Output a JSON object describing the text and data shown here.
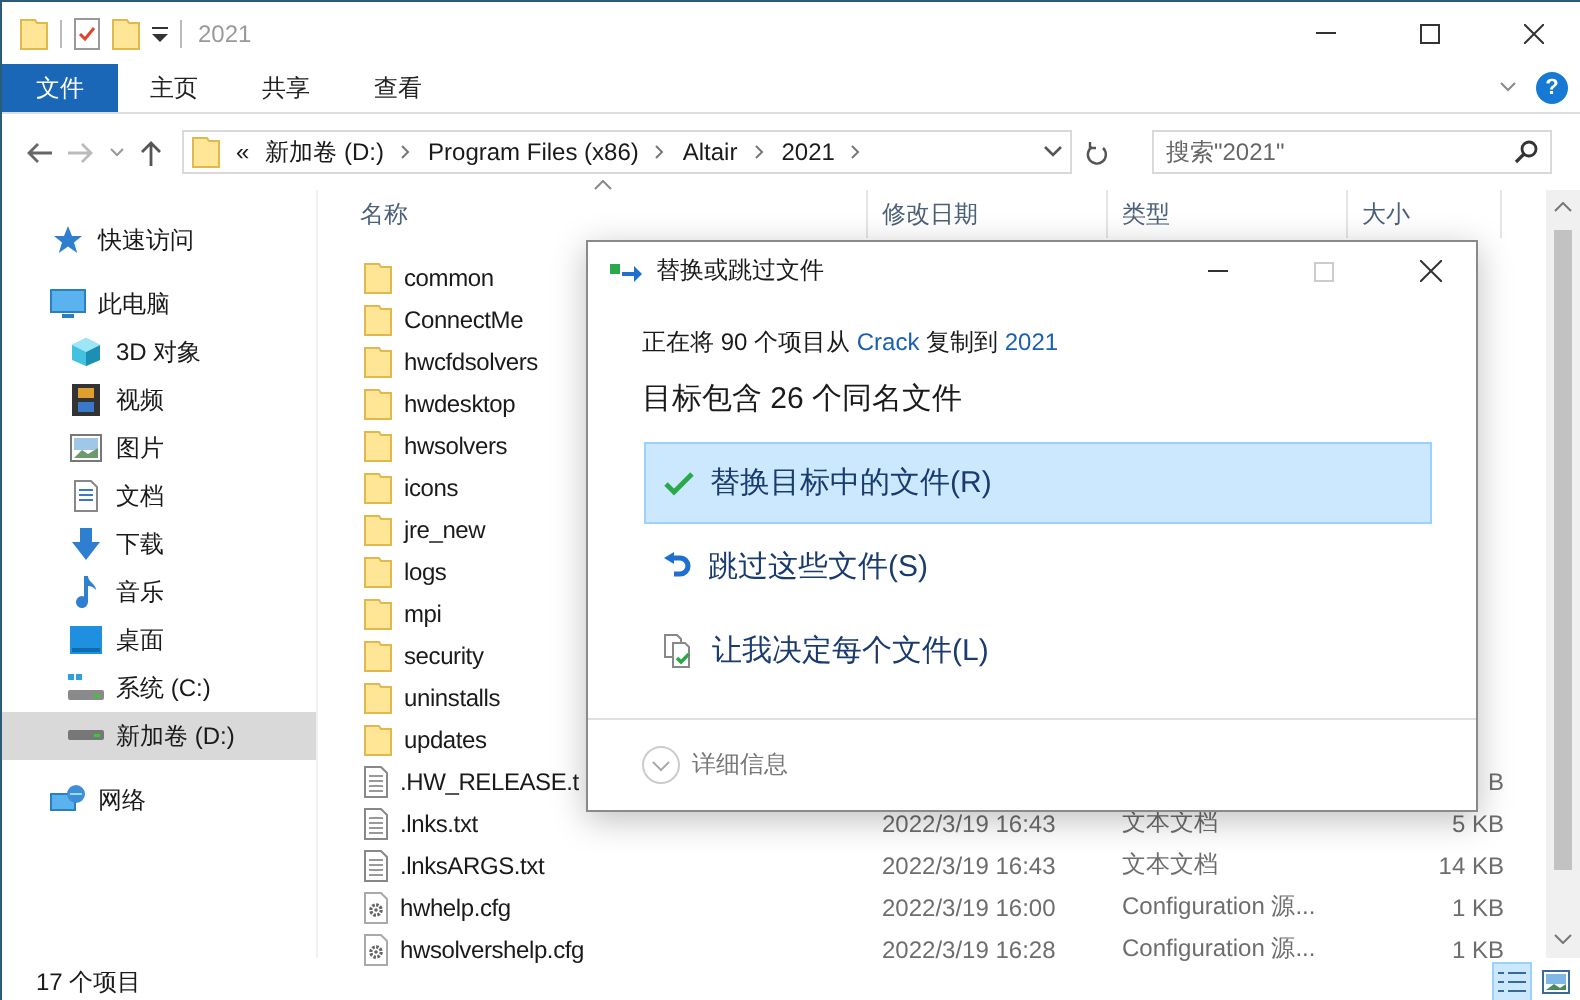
{
  "window": {
    "title": "2021",
    "help": "?"
  },
  "ribbon_tabs": [
    {
      "label": "文件",
      "kind": "file"
    },
    {
      "label": "主页",
      "kind": "tab"
    },
    {
      "label": "共享",
      "kind": "tab"
    },
    {
      "label": "查看",
      "kind": "tab"
    }
  ],
  "address_bar": {
    "overflow": "«",
    "crumbs": [
      "新加卷 (D:)",
      "Program Files (x86)",
      "Altair",
      "2021"
    ]
  },
  "search": {
    "placeholder": "搜索\"2021\""
  },
  "sidebar": {
    "items": [
      {
        "label": "快速访问",
        "kind": "star",
        "selected": false
      },
      {
        "label": "此电脑",
        "kind": "pc",
        "selected": false,
        "children": [
          {
            "label": "3D 对象",
            "kind": "cube",
            "selected": false
          },
          {
            "label": "视频",
            "kind": "video",
            "selected": false
          },
          {
            "label": "图片",
            "kind": "image",
            "selected": false
          },
          {
            "label": "文档",
            "kind": "document",
            "selected": false
          },
          {
            "label": "下载",
            "kind": "download",
            "selected": false
          },
          {
            "label": "音乐",
            "kind": "music",
            "selected": false
          },
          {
            "label": "桌面",
            "kind": "desktop",
            "selected": false
          },
          {
            "label": "系统 (C:)",
            "kind": "system-drive",
            "selected": false
          },
          {
            "label": "新加卷 (D:)",
            "kind": "drive",
            "selected": true
          }
        ]
      },
      {
        "label": "网络",
        "kind": "network",
        "selected": false
      }
    ]
  },
  "table": {
    "columns": [
      "名称",
      "修改日期",
      "类型",
      "大小"
    ],
    "rows": [
      {
        "name": "common",
        "kind": "folder"
      },
      {
        "name": "ConnectMe",
        "kind": "folder"
      },
      {
        "name": "hwcfdsolvers",
        "kind": "folder"
      },
      {
        "name": "hwdesktop",
        "kind": "folder"
      },
      {
        "name": "hwsolvers",
        "kind": "folder"
      },
      {
        "name": "icons",
        "kind": "folder"
      },
      {
        "name": "jre_new",
        "kind": "folder"
      },
      {
        "name": "logs",
        "kind": "folder"
      },
      {
        "name": "mpi",
        "kind": "folder"
      },
      {
        "name": "security",
        "kind": "folder"
      },
      {
        "name": "uninstalls",
        "kind": "folder"
      },
      {
        "name": "updates",
        "kind": "folder"
      },
      {
        "name": ".HW_RELEASE.t",
        "kind": "text",
        "size": "B"
      },
      {
        "name": ".lnks.txt",
        "kind": "text",
        "date": "2022/3/19 16:43",
        "type": "文本文档",
        "size": "5 KB"
      },
      {
        "name": ".lnksARGS.txt",
        "kind": "text",
        "date": "2022/3/19 16:43",
        "type": "文本文档",
        "size": "14 KB"
      },
      {
        "name": "hwhelp.cfg",
        "kind": "config",
        "date": "2022/3/19 16:00",
        "type": "Configuration 源...",
        "size": "1 KB"
      },
      {
        "name": "hwsolvershelp.cfg",
        "kind": "config",
        "date": "2022/3/19 16:28",
        "type": "Configuration 源...",
        "size": "1 KB"
      }
    ]
  },
  "status_bar": {
    "count": "17 个项目",
    "views": [
      {
        "kind": "details",
        "selected": true
      },
      {
        "kind": "thumbnails",
        "selected": false
      }
    ]
  },
  "dialog": {
    "title": "替换或跳过文件",
    "message": [
      {
        "kind": "text",
        "text": "正在将 90 个项目从 "
      },
      {
        "kind": "link",
        "text": "Crack"
      },
      {
        "kind": "text",
        "text": " 复制到 "
      },
      {
        "kind": "link",
        "text": "2021"
      }
    ],
    "heading": "目标包含 26 个同名文件",
    "options": [
      {
        "label": "替换目标中的文件(R)",
        "kind": "replace",
        "selected": true
      },
      {
        "label": "跳过这些文件(S)",
        "kind": "skip",
        "selected": false
      },
      {
        "label": "让我决定每个文件(L)",
        "kind": "decide",
        "selected": false
      }
    ],
    "details": "详细信息"
  }
}
